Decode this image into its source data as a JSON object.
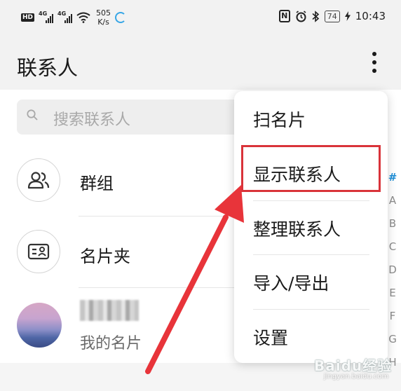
{
  "status_bar": {
    "hd_badge": "HD",
    "net_type_1": "4G",
    "net_type_2": "4G",
    "speed_value": "505",
    "speed_unit": "K/s",
    "nfc": "N",
    "battery": "74",
    "time": "10:43"
  },
  "header": {
    "title": "联系人"
  },
  "search": {
    "placeholder": "搜索联系人"
  },
  "list": {
    "groups_label": "群组",
    "cards_label": "名片夹",
    "my_card_label": "我的名片"
  },
  "index_bar": [
    "#",
    "A",
    "B",
    "C",
    "D",
    "E",
    "F",
    "G",
    "H"
  ],
  "menu": {
    "items": [
      {
        "label": "扫名片"
      },
      {
        "label": "显示联系人"
      },
      {
        "label": "整理联系人"
      },
      {
        "label": "导入/导出"
      },
      {
        "label": "设置"
      }
    ]
  },
  "watermark": {
    "main": "Baidu经验",
    "sub": "jingyan.baidu.com"
  },
  "colors": {
    "highlight_border": "#d9333a",
    "arrow": "#e8343a",
    "index_active": "#1e8fd8",
    "status_bar_bg": "#f2f2f2"
  }
}
